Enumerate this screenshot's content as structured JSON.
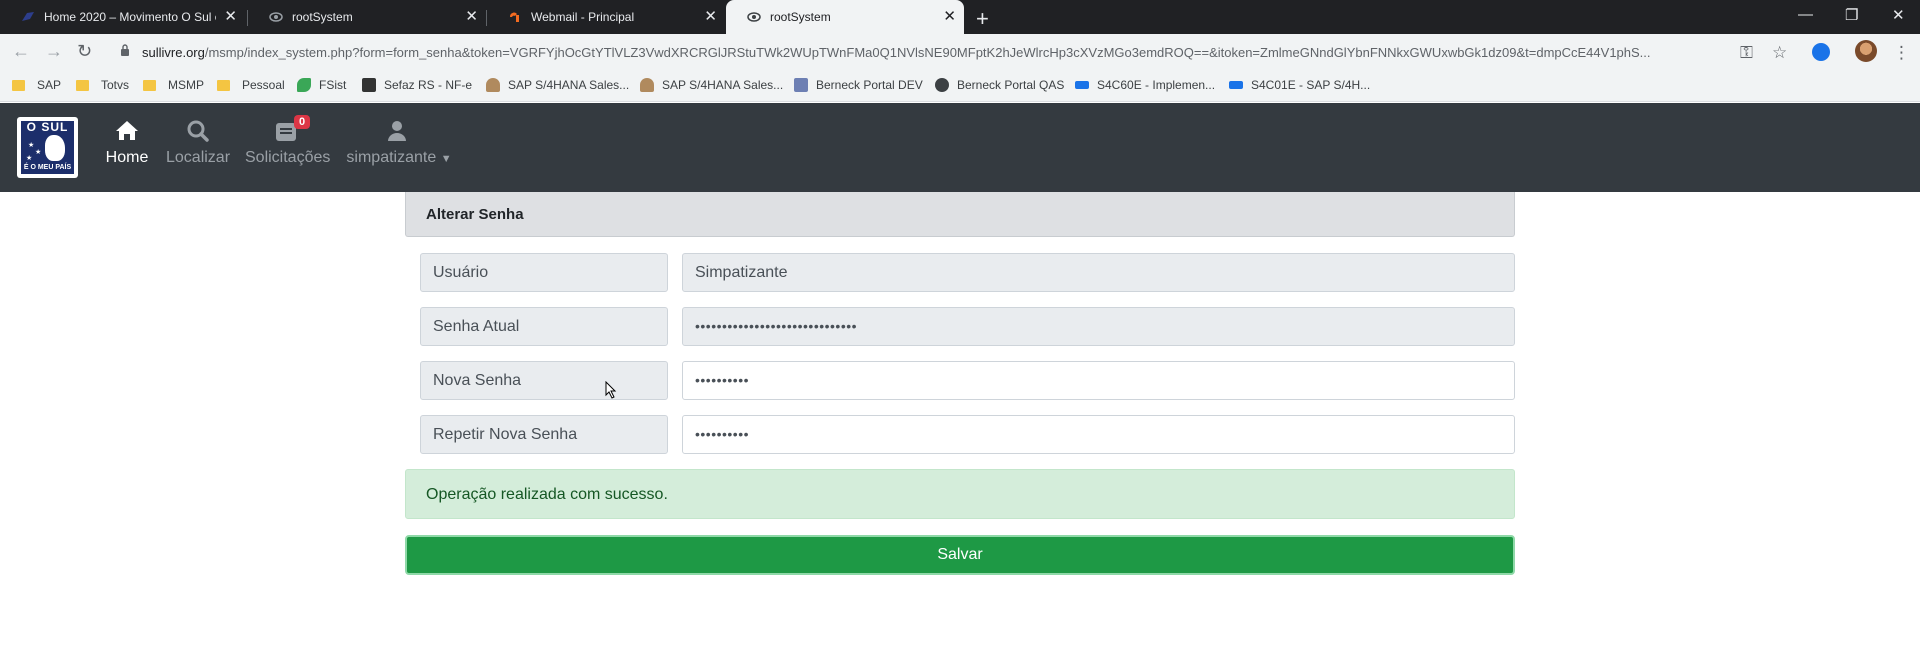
{
  "browser": {
    "tabs": [
      {
        "title": "Home 2020 – Movimento O Sul é",
        "active": false
      },
      {
        "title": "rootSystem",
        "active": false
      },
      {
        "title": "Webmail - Principal",
        "active": false
      },
      {
        "title": "rootSystem",
        "active": true
      }
    ],
    "url_host": "sullivre.org",
    "url_path": "/msmp/index_system.php?form=form_senha&token=VGRFYjhOcGtYTlVLZ3VwdXRCRGlJRStuTWk2WUpTWnFMa0Q1NVlsNE90MFptK2hJeWlrcHp3cXVzMGo3emdROQ==&itoken=ZmlmeGNndGlYbnFNNkxGWUxwbGk1dz09&t=dmpCcE44V1phS...",
    "bookmarks": [
      {
        "label": "SAP",
        "icon": "folder"
      },
      {
        "label": "Totvs",
        "icon": "folder"
      },
      {
        "label": "MSMP",
        "icon": "folder"
      },
      {
        "label": "Pessoal",
        "icon": "folder"
      },
      {
        "label": "FSist",
        "icon": "fsist"
      },
      {
        "label": "Sefaz RS - NF-e",
        "icon": "sefaz"
      },
      {
        "label": "SAP S/4HANA Sales...",
        "icon": "person"
      },
      {
        "label": "SAP S/4HANA Sales...",
        "icon": "person"
      },
      {
        "label": "Berneck Portal DEV",
        "icon": "portal"
      },
      {
        "label": "Berneck Portal QAS",
        "icon": "globe"
      },
      {
        "label": "S4C60E - Implemen...",
        "icon": "sap"
      },
      {
        "label": "S4C01E - SAP S/4H...",
        "icon": "sap"
      }
    ]
  },
  "app": {
    "logo_top": "O SUL",
    "logo_bottom": "É O MEU PAÍS",
    "nav": [
      {
        "label": "Home",
        "icon": "home-icon",
        "active": true
      },
      {
        "label": "Localizar",
        "icon": "search-icon",
        "active": false
      },
      {
        "label": "Solicitações",
        "icon": "inbox-icon",
        "active": false,
        "badge": "0"
      },
      {
        "label": "simpatizante",
        "icon": "user-icon",
        "active": false,
        "dropdown": true
      }
    ]
  },
  "form": {
    "title": "Alterar Senha",
    "fields": [
      {
        "label": "Usuário",
        "value": "Simpatizante",
        "readonly": true
      },
      {
        "label": "Senha Atual",
        "value": "••••••••••••••••••••••••••••••",
        "readonly": true
      },
      {
        "label": "Nova Senha",
        "value": "••••••••••",
        "readonly": false
      },
      {
        "label": "Repetir Nova Senha",
        "value": "••••••••••",
        "readonly": false
      }
    ],
    "alert": "Operação realizada com sucesso.",
    "save_label": "Salvar"
  },
  "colors": {
    "navbar": "#343a40",
    "success_bg": "#d4edda",
    "success_text": "#155724",
    "button": "#1e9945",
    "badge": "#dc3545"
  }
}
